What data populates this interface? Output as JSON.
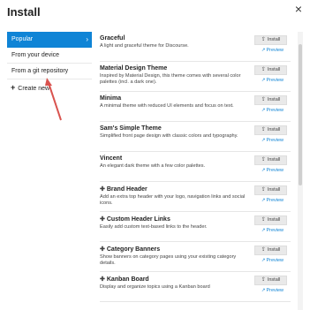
{
  "modal": {
    "title": "Install",
    "close_glyph": "×"
  },
  "sidebar": {
    "items": [
      {
        "label": "Popular",
        "active": true
      },
      {
        "label": "From your device",
        "active": false
      },
      {
        "label": "From a git repository",
        "active": false
      }
    ],
    "create_label": "Create new"
  },
  "themes": [
    {
      "name": "Graceful",
      "component": false,
      "desc": "A light and graceful theme for Discourse."
    },
    {
      "name": "Material Design Theme",
      "component": false,
      "desc": "Inspired by Material Design, this theme comes with several color palettes (incl. a dark one)."
    },
    {
      "name": "Minima",
      "component": false,
      "desc": "A minimal theme with reduced UI elements and focus on text."
    },
    {
      "name": "Sam's Simple Theme",
      "component": false,
      "desc": "Simplified front page design with classic colors and typography."
    },
    {
      "name": "Vincent",
      "component": false,
      "desc": "An elegant dark theme with a few color palettes."
    },
    {
      "name": "Brand Header",
      "component": true,
      "desc": "Add an extra top header with your logo, navigation links and social icons."
    },
    {
      "name": "Custom Header Links",
      "component": true,
      "desc": "Easily add custom text-based links to the header."
    },
    {
      "name": "Category Banners",
      "component": true,
      "desc": "Show banners on category pages using your existing category details."
    },
    {
      "name": "Kanban Board",
      "component": true,
      "desc": "Display and organize topics using a Kanban board"
    }
  ],
  "labels": {
    "install": "Install",
    "preview": "Preview"
  },
  "colors": {
    "accent": "#0f84d6",
    "annotation_arrow": "#d9534f"
  }
}
